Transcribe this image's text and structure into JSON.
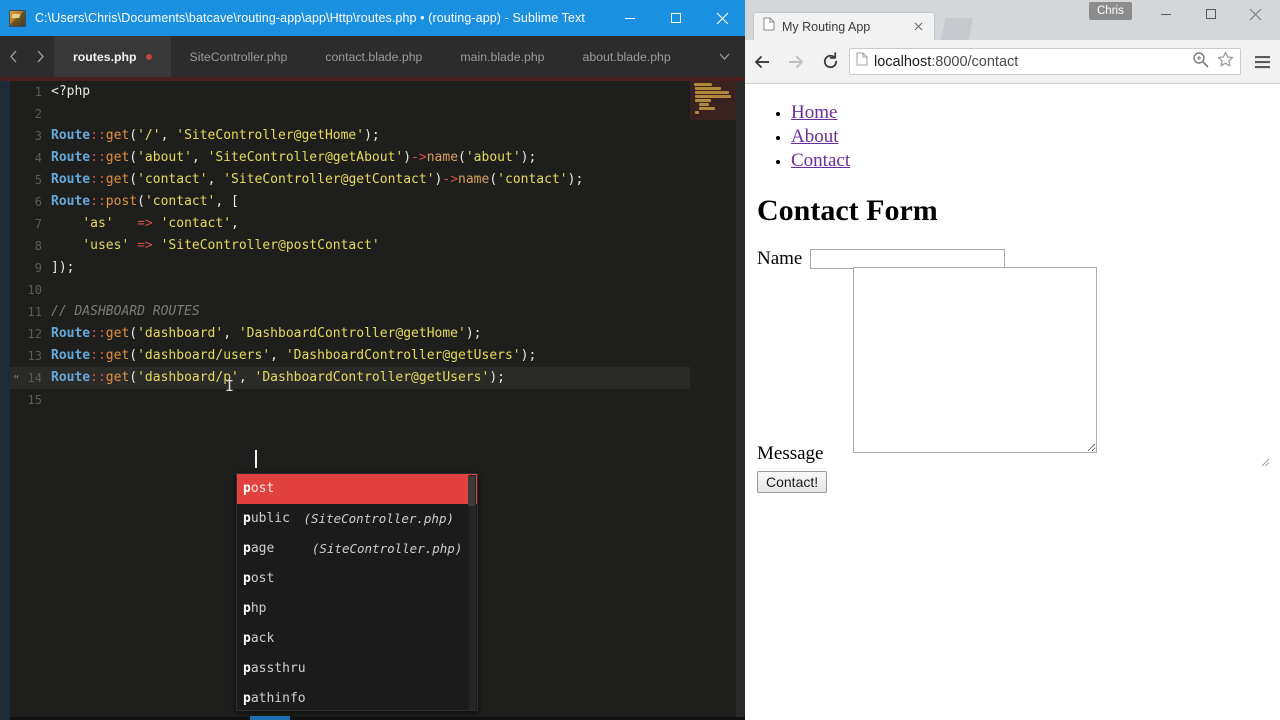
{
  "sublime": {
    "title": "C:\\Users\\Chris\\Documents\\batcave\\routing-app\\app\\Http\\routes.php • (routing-app) - Sublime Text",
    "app_icon": "sublime-text-icon",
    "window_controls": {
      "minimize": "minimize-icon",
      "maximize": "maximize-icon",
      "close": "close-icon"
    },
    "tab_nav": {
      "prev": "chevron-left-icon",
      "next": "chevron-right-icon",
      "dropdown": "chevron-down-icon"
    },
    "tabs": [
      {
        "label": "routes.php",
        "active": true,
        "unsaved": true
      },
      {
        "label": "SiteController.php",
        "active": false,
        "unsaved": false
      },
      {
        "label": "contact.blade.php",
        "active": false,
        "unsaved": false
      },
      {
        "label": "main.blade.php",
        "active": false,
        "unsaved": false
      },
      {
        "label": "about.blade.php",
        "active": false,
        "unsaved": false
      }
    ],
    "line_numbers": [
      "1",
      "2",
      "3",
      "4",
      "5",
      "6",
      "7",
      "8",
      "9",
      "10",
      "11",
      "12",
      "13",
      "14",
      "15"
    ],
    "code_plain": [
      "<?php",
      "",
      "Route::get('/', 'SiteController@getHome');",
      "Route::get('about', 'SiteController@getAbout')->name('about');",
      "Route::get('contact', 'SiteController@getContact')->name('contact');",
      "Route::post('contact', [",
      "    'as'   => 'contact',",
      "    'uses' => 'SiteController@postContact'",
      "]);",
      "",
      "// DASHBOARD ROUTES",
      "Route::get('dashboard', 'DashboardController@getHome');",
      "Route::get('dashboard/users', 'DashboardController@getUsers');",
      "Route::get('dashboard/p', 'DashboardController@getUsers');",
      ""
    ],
    "current_line": 14,
    "fold_marker": "“",
    "syntax_colors": {
      "keyword": "#66a9d9",
      "operator": "#d0504a",
      "function": "#e0913c",
      "method": "#d9a25f",
      "string": "#e6db5a",
      "comment": "#7a7c75",
      "text": "#e8e8e3",
      "background": "#1e1f1c",
      "titlebar": "#1b8fe0",
      "accent_red": "#e2423f"
    },
    "autocomplete": {
      "selected_index": 0,
      "items": [
        {
          "prefix": "p",
          "rest": "ost",
          "hint": ""
        },
        {
          "prefix": "p",
          "rest": "ublic",
          "hint": "(SiteController.php)"
        },
        {
          "prefix": "p",
          "rest": "age",
          "hint": "(SiteController.php)"
        },
        {
          "prefix": "p",
          "rest": "ost",
          "hint": ""
        },
        {
          "prefix": "p",
          "rest": "hp",
          "hint": ""
        },
        {
          "prefix": "p",
          "rest": "ack",
          "hint": ""
        },
        {
          "prefix": "p",
          "rest": "assthru",
          "hint": ""
        },
        {
          "prefix": "p",
          "rest": "athinfo",
          "hint": ""
        }
      ]
    }
  },
  "browser": {
    "profile_name": "Chris",
    "window_controls": {
      "minimize": "minimize-icon",
      "maximize": "maximize-icon",
      "close": "close-icon"
    },
    "tab": {
      "title": "My Routing App",
      "favicon": "page-icon",
      "close": "close-icon"
    },
    "new_tab_label": "new-tab-button",
    "toolbar": {
      "back": "back-arrow-icon",
      "forward": "forward-arrow-icon",
      "reload": "reload-icon",
      "zoom": "zoom-magnifier-icon",
      "bookmark": "star-icon",
      "menu": "hamburger-menu-icon"
    },
    "url": {
      "secure_icon": "page-icon",
      "host": "localhost",
      "rest": ":8000/contact",
      "full": "localhost:8000/contact"
    },
    "page": {
      "nav_links": [
        "Home",
        "About",
        "Contact"
      ],
      "heading": "Contact Form",
      "fields": [
        {
          "label": "Name",
          "type": "text",
          "value": "",
          "placeholder": ""
        },
        {
          "label": "Message",
          "type": "textarea",
          "value": "",
          "placeholder": ""
        }
      ],
      "submit_label": "Contact!",
      "link_color": "#6b2d9b"
    }
  }
}
